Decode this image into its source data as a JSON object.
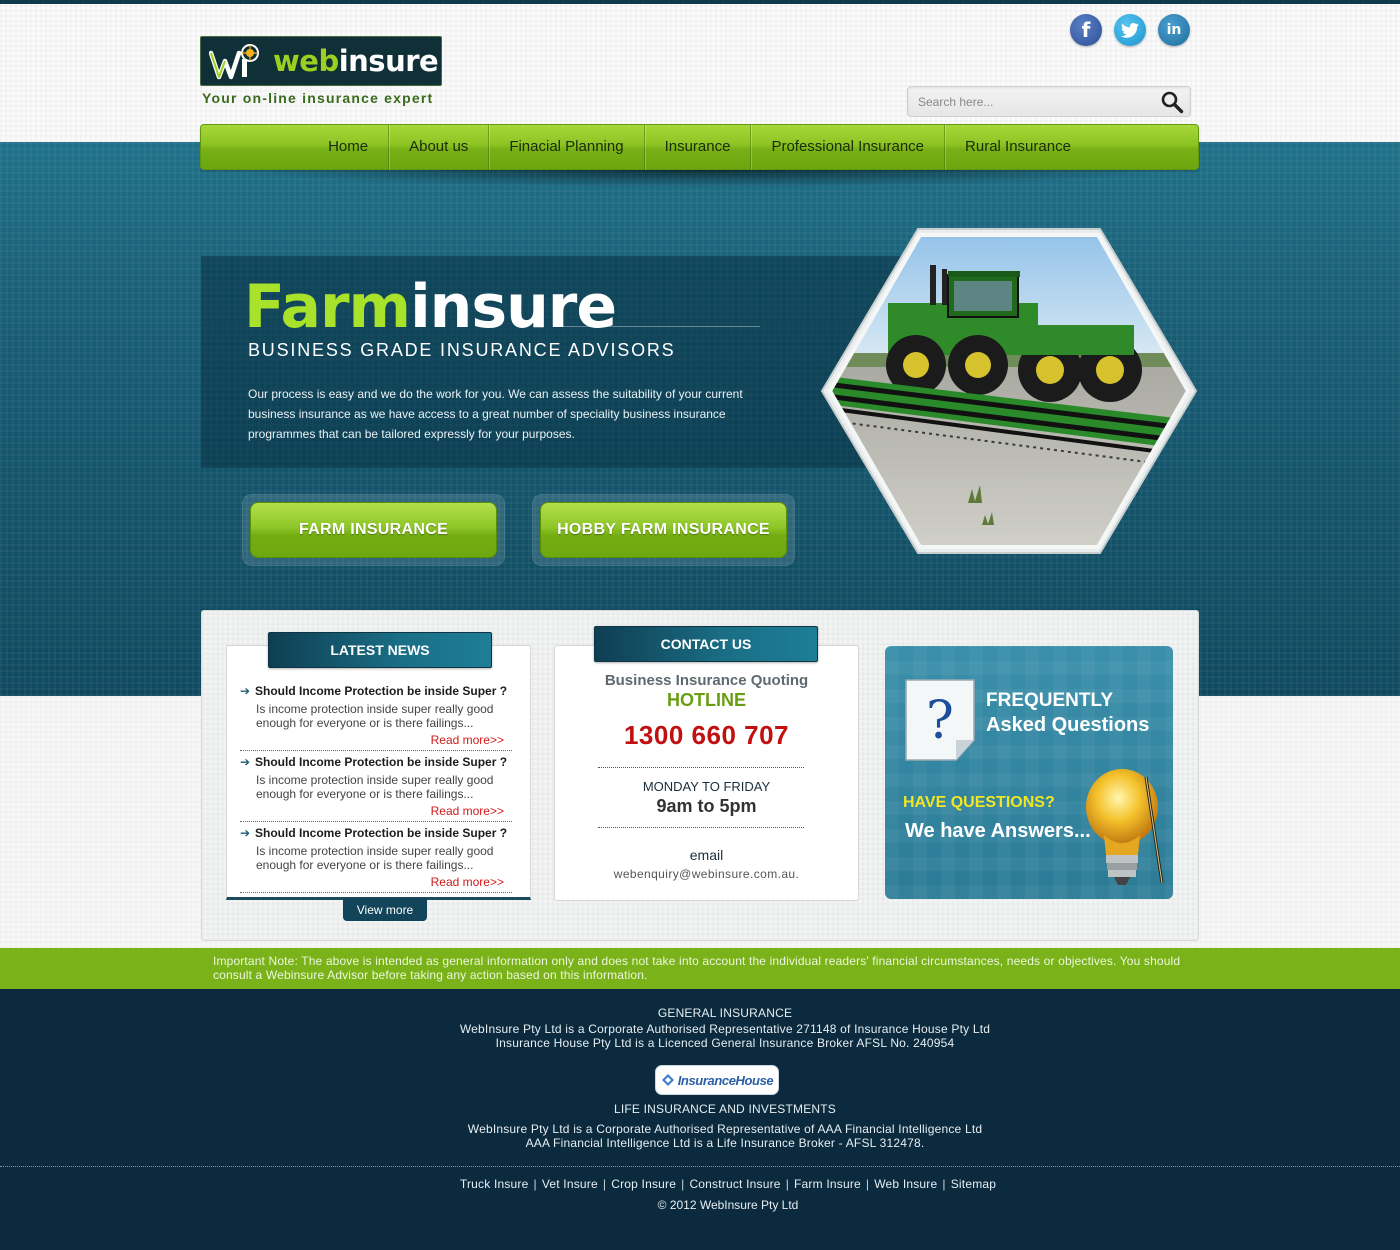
{
  "brand": {
    "logo_word1": "web",
    "logo_word2": "insure",
    "tagline": "Your on-line insurance expert"
  },
  "social": [
    {
      "name": "facebook",
      "icon": "facebook-icon",
      "glyph": "f",
      "color": "#3b5998"
    },
    {
      "name": "twitter",
      "icon": "twitter-icon",
      "glyph": "t",
      "color": "#1da1f2"
    },
    {
      "name": "linkedin",
      "icon": "linkedin-icon",
      "glyph": "in",
      "color": "#1e6e9e"
    }
  ],
  "search": {
    "placeholder": "Search here...",
    "icon": "search-icon"
  },
  "nav": {
    "items": [
      "Home",
      "About us",
      "Finacial Planning",
      "Insurance",
      "Professional Insurance",
      "Rural Insurance"
    ]
  },
  "hero": {
    "title_part1": "Farm",
    "title_part2": "insure",
    "subtitle": "BUSINESS GRADE INSURANCE ADVISORS",
    "description": "Our process is easy and we do the work for you. We can assess the suitability of your current business insurance as we have access to a great number of speciality business insurance programmes that can be tailored expressly for your purposes.",
    "buttons": [
      "FARM INSURANCE",
      "HOBBY FARM INSURANCE"
    ],
    "image": "tractor-photo"
  },
  "news": {
    "heading": "LATEST NEWS",
    "items": [
      {
        "title": "Should Income Protection be inside Super ?",
        "body": "Is income protection inside super really good enough for everyone or is there failings...",
        "more": "Read more>>"
      },
      {
        "title": "Should Income Protection be inside Super ?",
        "body": "Is income protection inside super really good enough for everyone or is there failings...",
        "more": "Read more>>"
      },
      {
        "title": "Should Income Protection be inside Super ?",
        "body": "Is income protection inside super really good enough for everyone or is there failings...",
        "more": "Read more>>"
      }
    ],
    "view_more": "View more"
  },
  "contact": {
    "heading": "CONTACT US",
    "quoting": "Business Insurance Quoting",
    "hotline": "HOTLINE",
    "phone": "1300 660 707",
    "days": "MONDAY TO FRIDAY",
    "hours": "9am to 5pm",
    "email_label": "email",
    "email": "webenquiry@webinsure.com.au."
  },
  "faq": {
    "line1": "FREQUENTLY",
    "line2": "Asked Questions",
    "question": "HAVE QUESTIONS?",
    "answer": "We have Answers...",
    "icons": [
      "question-document-icon",
      "lightbulb-icon"
    ]
  },
  "note": "Important Note: The above is intended as general information only and does not take into account the individual readers' financial circumstances, needs or objectives. You should consult a Webinsure Advisor before taking any action based on this information.",
  "footer": {
    "general_heading": "GENERAL INSURANCE",
    "general_line1": "WebInsure Pty Ltd is a Corporate Authorised Representative 271148 of Insurance House Pty Ltd",
    "general_line2": "Insurance House Pty Ltd is a Licenced General Insurance Broker AFSL No. 240954",
    "partner_logo": "InsuranceHouse",
    "life_heading": "LIFE INSURANCE AND INVESTMENTS",
    "life_line1": "WebInsure Pty Ltd is a Corporate Authorised Representative of AAA Financial Intelligence Ltd",
    "life_line2": "AAA Financial Intelligence Ltd is a Life Insurance Broker - AFSL 312478.",
    "links": [
      "Truck Insure",
      "Vet Insure",
      "Crop Insure",
      "Construct Insure",
      "Farm Insure",
      "Web Insure",
      "Sitemap"
    ],
    "copyright": "© 2012 WebInsure Pty Ltd"
  },
  "colors": {
    "accent_green": "#8cc322",
    "hero_blue": "#1a6078",
    "footer_navy": "#0c2a3e",
    "phone_red": "#c01010",
    "faq_yellow": "#f2e623"
  }
}
